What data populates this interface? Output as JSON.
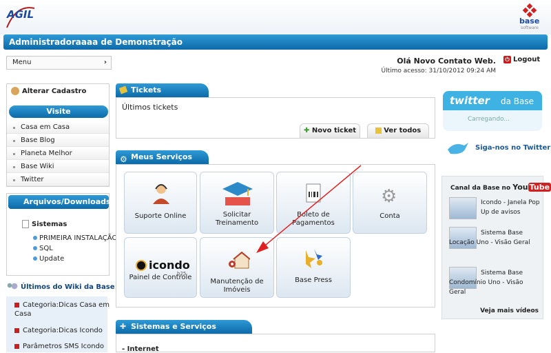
{
  "header": {
    "logo_left": "AGIL",
    "logo_right": "base",
    "logo_right_sub": "software"
  },
  "titlebar": {
    "title": "Administradoraaaa de Demonstração"
  },
  "menu": {
    "label": "Menu"
  },
  "user": {
    "greeting": "Olá Novo Contato Web.",
    "last_access": "Último acesso: 31/10/2012  09:24 AM",
    "logout": "Logout"
  },
  "sidebar": {
    "alterar": "Alterar Cadastro",
    "visite_title": "Visite",
    "visite": [
      "Casa em Casa",
      "Base Blog",
      "Planeta Melhor",
      "Base Wiki",
      "Twitter"
    ],
    "arquivos_title": "Arquivos/Downloads",
    "sistemas": "Sistemas",
    "arquivos": [
      "PRIMEIRA INSTALAÇÃO",
      "SQL",
      "Update"
    ],
    "wiki_title": "Últimos do Wiki da Base",
    "wiki": [
      "Categoria:Dicas Casa em Casa",
      "Categoria:Dicas Icondo",
      "Parâmetros SMS Icondo"
    ]
  },
  "tickets": {
    "title": "Tickets",
    "subtitle": "Últimos tickets",
    "new_btn": "Novo ticket",
    "all_btn": "Ver todos"
  },
  "servicos": {
    "title": "Meus Serviços",
    "tiles": [
      "Suporte Online",
      "Solicitar Treinamento",
      "Boleto de Pagamentos",
      "Conta",
      "Painel de Controle",
      "Manutenção de Imóveis",
      "Base Press"
    ],
    "icondo_logo": "icondo",
    "icondo_sub": "b25"
  },
  "sugeridos": {
    "title": "Sistemas e Serviços Sugeridos",
    "first": "- Internet"
  },
  "twitter": {
    "brand": "twitter",
    "suffix": "da Base",
    "loading": "Carregando...",
    "follow": "Siga-nos no Twitter"
  },
  "youtube": {
    "title": "Canal da Base no",
    "brand_you": "You",
    "brand_tube": "Tube",
    "videos": [
      "Icondo - Janela Pop Up de avisos",
      "Sistema Base Locação Uno - Visão Geral",
      "Sistema Base Condomínio Uno - Visão Geral"
    ],
    "more": "Veja mais vídeos"
  },
  "colors": {
    "accent": "#1582c5",
    "dark_accent": "#0d6aa8",
    "logout": "#d01818"
  }
}
